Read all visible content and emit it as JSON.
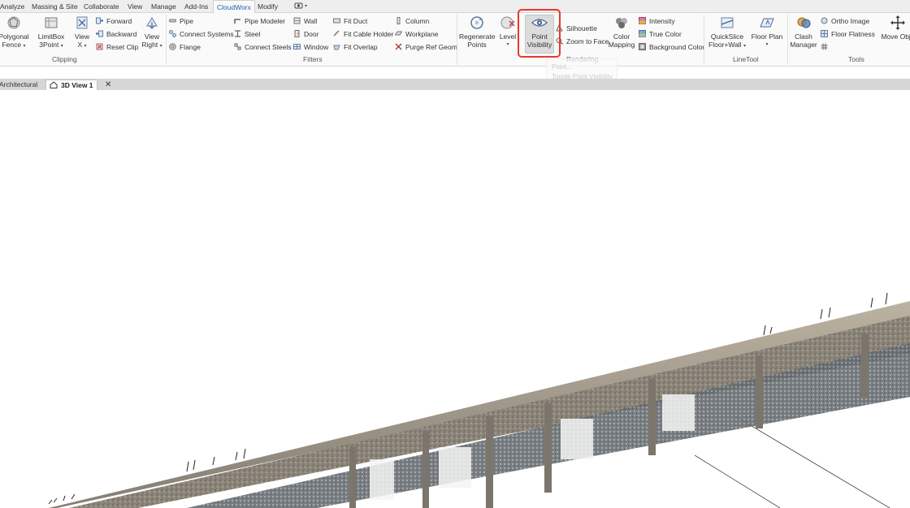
{
  "ribbon_tabs": [
    "Analyze",
    "Massing & Site",
    "Collaborate",
    "View",
    "Manage",
    "Add-Ins",
    "CloudWorx",
    "Modify"
  ],
  "active_tab": "CloudWorx",
  "clipping": {
    "group": "Clipping",
    "polygonal_fence": [
      "Polygonal",
      "Fence"
    ],
    "limitbox": [
      "LimitBox",
      "3Point"
    ],
    "view_x": [
      "View",
      "X"
    ],
    "forward": "Forward",
    "backward": "Backward",
    "reset_clip": "Reset Clip",
    "view_right": [
      "View",
      "Right"
    ]
  },
  "fitters": {
    "group": "Fitters",
    "pipe": "Pipe",
    "connect_systems": "Connect  Systems",
    "flange": "Flange",
    "pipe_modeler": "Pipe Modeler",
    "steel": "Steel",
    "connect_steels": "Connect  Steels",
    "wall": "Wall",
    "door": "Door",
    "window": "Window",
    "fit_duct": "Fit Duct",
    "fit_cable_holder": "Fit Cable Holder",
    "fit_overlap": "Fit Overlap",
    "column": "Column",
    "workplane": "Workplane",
    "purge_ref_geom": "Purge  Ref Geom"
  },
  "rendering": {
    "group": "Rendering",
    "regenerate": [
      "Regenerate",
      "Points"
    ],
    "level": "Level",
    "point_visibility": [
      "Point",
      "Visibility"
    ],
    "silhouette": "Silhouette",
    "zoom_to_face": "Zoom to Face",
    "color_mapping": [
      "Color",
      "Mapping"
    ],
    "intensity": "Intensity",
    "true_color": "True  Color",
    "background_color": "Background Color"
  },
  "linetool": {
    "group": "LineTool",
    "quickslice": [
      "QuickSlice",
      "Floor+Wall"
    ],
    "floor_plan": "Floor Plan"
  },
  "tools": {
    "group": "Tools",
    "clash_manager": [
      "Clash",
      "Manager"
    ],
    "ortho_image": "Ortho  Image",
    "floor_flatness": "Floor  Flatness",
    "move_obj": "Move Obje"
  },
  "tooltip": {
    "line1": "Point...",
    "line2": "Toggle Point Visibility"
  },
  "view_tabs": {
    "architectural": "Architectural",
    "active": "3D View 1",
    "close": "✕"
  },
  "colors": {
    "highlight": "#e8392f",
    "accent": "#1f5fa8",
    "concrete": "#8c857a"
  }
}
